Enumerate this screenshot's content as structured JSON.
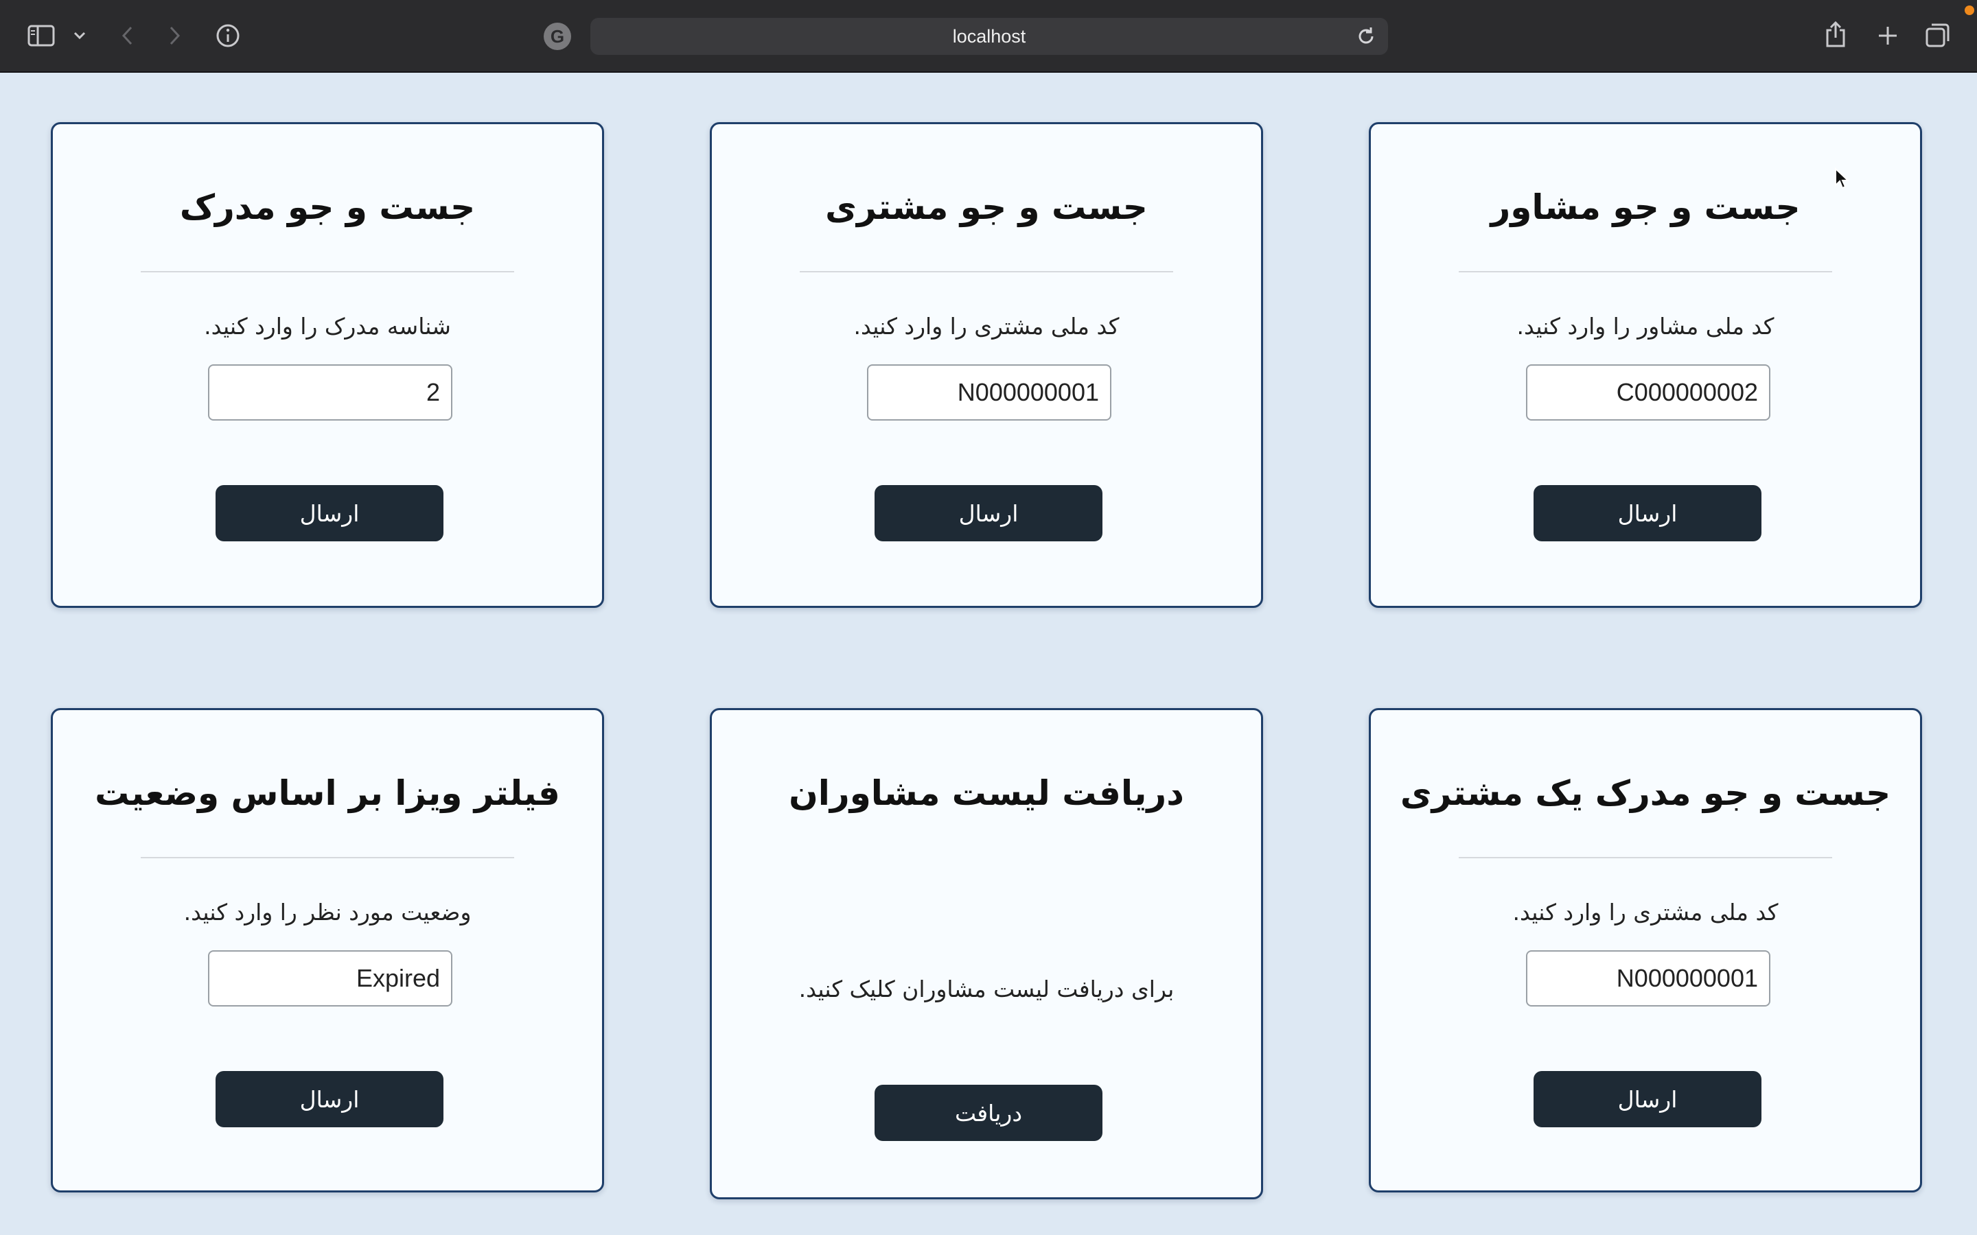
{
  "browser": {
    "url": "localhost",
    "sidebar_icon": "sidebar-icon",
    "back_icon": "chevron-left-icon",
    "forward_icon": "chevron-right-icon",
    "info_icon": "info-icon",
    "grammarly_badge": "G",
    "reload_icon": "reload-icon",
    "share_icon": "share-icon",
    "new_tab_icon": "plus-icon",
    "tabs_icon": "tabs-overview-icon"
  },
  "cards": [
    {
      "title": "جست و جو مشاور",
      "description": "کد ملی مشاور را وارد کنید.",
      "input_value": "C000000002",
      "button_label": "ارسال"
    },
    {
      "title": "جست و جو مشتری",
      "description": "کد ملی مشتری را وارد کنید.",
      "input_value": "N000000001",
      "button_label": "ارسال"
    },
    {
      "title": "جست و جو مدرک",
      "description": "شناسه مدرک را وارد کنید.",
      "input_value": "2",
      "button_label": "ارسال"
    },
    {
      "title": "جست و جو مدرک یک مشتری",
      "description": "کد ملی مشتری را وارد کنید.",
      "input_value": "N000000001",
      "button_label": "ارسال"
    },
    {
      "title": "دریافت لیست مشاوران",
      "description": "برای دریافت لیست مشاوران کلیک کنید.",
      "button_label": "دریافت"
    },
    {
      "title": "فیلتر ویزا بر اساس وضعیت",
      "description": "وضعیت مورد نظر را وارد کنید.",
      "input_value": "Expired",
      "button_label": "ارسال"
    }
  ],
  "colors": {
    "page_background": "#dde8f3",
    "card_background": "#f8fcff",
    "card_border": "#1f3f6a",
    "button_background": "#1e2a35",
    "toolbar_background": "#2b2b2d"
  }
}
